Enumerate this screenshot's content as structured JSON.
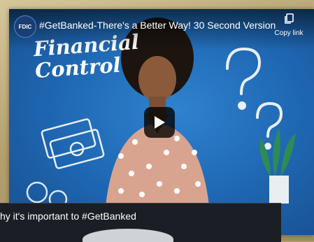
{
  "player": {
    "channel_logo": "FDIC",
    "title": "#GetBanked-There's a Better Way! 30 Second Version",
    "copy_link_label": "Copy link",
    "headline": "Financial Control"
  },
  "bottom_panel": {
    "title": "hy it's important to #GetBanked"
  },
  "icons": [
    "copy-icon",
    "play-icon"
  ]
}
